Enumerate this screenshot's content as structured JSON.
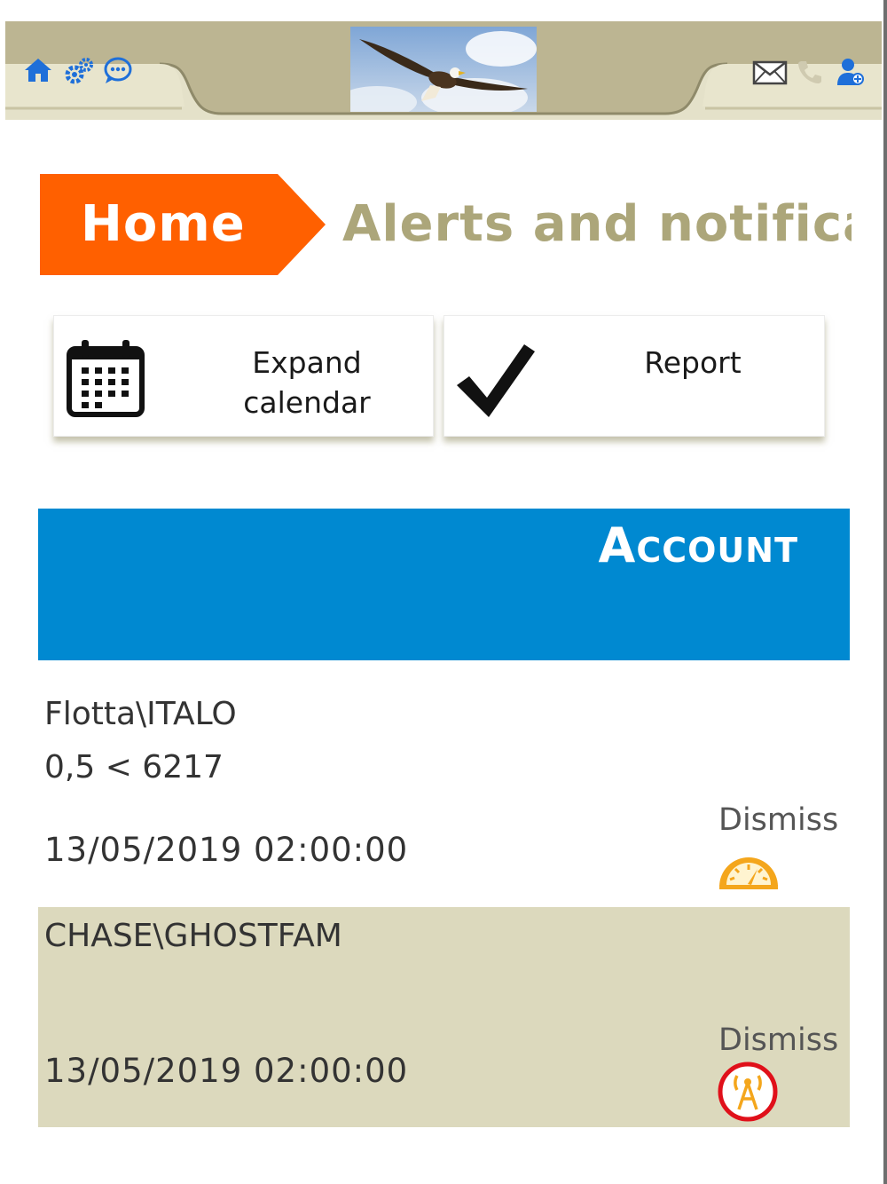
{
  "header": {
    "left_icons": [
      "home-icon",
      "gear-icon",
      "chat-icon"
    ],
    "logo": "eagle-logo",
    "right_icons": [
      "mail-icon",
      "phone-icon",
      "user-icon"
    ]
  },
  "breadcrumb": {
    "home_label": "Home",
    "title": "Alerts and notifica"
  },
  "actions": {
    "expand_calendar_line1": "Expand",
    "expand_calendar_line2": "calendar",
    "report_label": "Report"
  },
  "account": {
    "title": "Account"
  },
  "alerts": [
    {
      "name": "Flotta\\ITALO",
      "condition": "0,5 < 6217",
      "datetime": "13/05/2019 02:00:00",
      "dismiss": "Dismiss",
      "icon": "speedometer-icon"
    },
    {
      "name": "CHASE\\GHOSTFAM",
      "condition": "",
      "datetime": "13/05/2019 02:00:00",
      "dismiss": "Dismiss",
      "icon": "antenna-icon"
    }
  ],
  "colors": {
    "brand_orange": "#ff6000",
    "title_olive": "#aca67a",
    "account_blue": "#0089d1",
    "row_alt_bg": "#dcd9bd",
    "header_icon_blue": "#1e6fd9",
    "alert_icon_orange": "#f4a61c",
    "alert_ring_red": "#e0101a"
  }
}
